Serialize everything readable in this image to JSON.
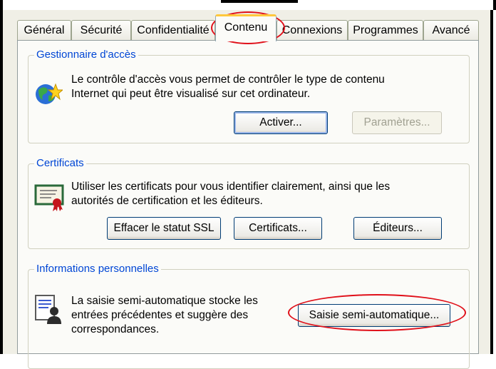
{
  "tabs": [
    {
      "label": "Général",
      "active": false
    },
    {
      "label": "Sécurité",
      "active": false
    },
    {
      "label": "Confidentialité",
      "active": false
    },
    {
      "label": "Contenu",
      "active": true
    },
    {
      "label": "Connexions",
      "active": false
    },
    {
      "label": "Programmes",
      "active": false
    },
    {
      "label": "Avancé",
      "active": false
    }
  ],
  "access": {
    "title": "Gestionnaire d'accès",
    "desc_line1": "Le contrôle d'accès vous permet de contrôler le type de contenu",
    "desc_line2": "Internet qui peut être visualisé sur cet ordinateur.",
    "activate_label": "Activer...",
    "settings_label": "Paramètres...",
    "icon": "globe-star-icon"
  },
  "certificates": {
    "title": "Certificats",
    "desc_line1": "Utiliser les certificats pour vous identifier clairement, ainsi que les",
    "desc_line2": "autorités de certification et les éditeurs.",
    "clear_ssl_label": "Effacer le statut SSL",
    "certificates_label": "Certificats...",
    "publishers_label": "Éditeurs...",
    "icon": "certificate-icon"
  },
  "personal": {
    "title": "Informations personnelles",
    "desc_line1": "La saisie semi-automatique stocke les",
    "desc_line2": "entrées précédentes et suggère des",
    "desc_line3": "correspondances.",
    "autocomplete_label": "Saisie semi-automatique...",
    "icon": "document-person-icon"
  },
  "colors": {
    "group_title": "#0046d5",
    "annotation": "#e0101a",
    "active_tab_accent": "#ffc83c"
  }
}
